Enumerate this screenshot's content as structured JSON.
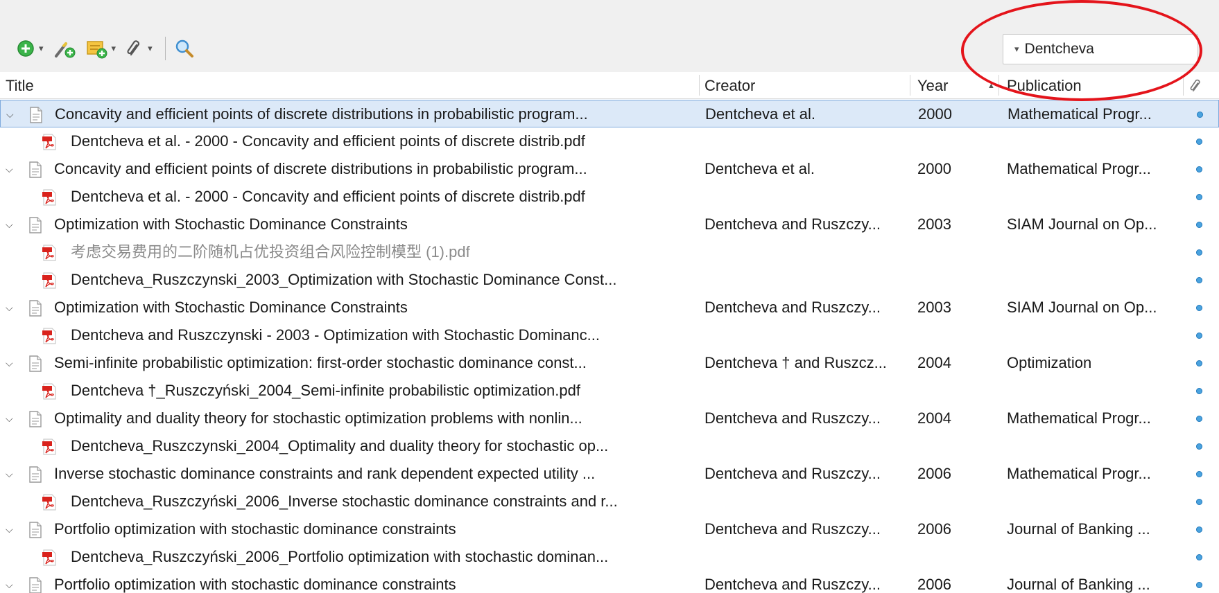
{
  "toolbar": {
    "buttons": [
      {
        "name": "new-item-button",
        "icon": "plus-circle-icon",
        "has_menu": true
      },
      {
        "name": "add-by-identifier-button",
        "icon": "magic-wand-icon",
        "has_menu": false
      },
      {
        "name": "new-note-button",
        "icon": "note-add-icon",
        "has_menu": true
      },
      {
        "name": "add-attachment-button",
        "icon": "paperclip-icon",
        "has_menu": true
      },
      {
        "name": "advanced-search-button",
        "icon": "magnifier-icon",
        "has_menu": false
      }
    ],
    "menu_caret": "▾"
  },
  "search": {
    "mode_caret": "▾",
    "value": "Dentcheva"
  },
  "columns": {
    "title": "Title",
    "creator": "Creator",
    "year": "Year",
    "publication": "Publication",
    "attachments_icon": "paperclip-icon",
    "sort_indicator": "▲"
  },
  "chevron": "⌵",
  "colors": {
    "selection_bg": "#dce9f8",
    "selection_border": "#7eaadd",
    "attachment_dot": "#4aa3df",
    "annotation_ring": "#e4141b",
    "pdf_red": "#d9221c"
  },
  "rows": [
    {
      "type": "parent",
      "title": "Concavity and efficient points of discrete distributions in probabilistic program...",
      "creator": "Dentcheva et al.",
      "year": "2000",
      "publication": "Mathematical Progr...",
      "selected": true
    },
    {
      "type": "child",
      "title": "Dentcheva et al. - 2000 - Concavity and efficient points of discrete distrib.pdf"
    },
    {
      "type": "parent",
      "title": "Concavity and efficient points of discrete distributions in probabilistic program...",
      "creator": "Dentcheva et al.",
      "year": "2000",
      "publication": "Mathematical Progr..."
    },
    {
      "type": "child",
      "title": "Dentcheva et al. - 2000 - Concavity and efficient points of discrete distrib.pdf"
    },
    {
      "type": "parent",
      "title": "Optimization with Stochastic Dominance Constraints",
      "creator": "Dentcheva and Ruszczy...",
      "year": "2003",
      "publication": "SIAM Journal on Op..."
    },
    {
      "type": "child",
      "title": "考虑交易费用的二阶随机占优投资组合风险控制模型 (1).pdf",
      "grey": true
    },
    {
      "type": "child",
      "title": "Dentcheva_Ruszczynski_2003_Optimization with Stochastic Dominance Const..."
    },
    {
      "type": "parent",
      "title": "Optimization with Stochastic Dominance Constraints",
      "creator": "Dentcheva and Ruszczy...",
      "year": "2003",
      "publication": "SIAM Journal on Op..."
    },
    {
      "type": "child",
      "title": "Dentcheva and Ruszczynski - 2003 - Optimization with Stochastic Dominanc..."
    },
    {
      "type": "parent",
      "title": "Semi-infinite probabilistic optimization: first-order stochastic dominance const...",
      "creator": "Dentcheva † and Ruszcz...",
      "year": "2004",
      "publication": "Optimization"
    },
    {
      "type": "child",
      "title": "Dentcheva †_Ruszczyński_2004_Semi-infinite probabilistic optimization.pdf"
    },
    {
      "type": "parent",
      "title": "Optimality and duality theory for stochastic optimization problems with nonlin...",
      "creator": "Dentcheva and Ruszczy...",
      "year": "2004",
      "publication": "Mathematical Progr..."
    },
    {
      "type": "child",
      "title": "Dentcheva_Ruszczynski_2004_Optimality and duality theory for stochastic op..."
    },
    {
      "type": "parent",
      "title": "Inverse stochastic dominance constraints and rank dependent expected utility ...",
      "creator": "Dentcheva and Ruszczy...",
      "year": "2006",
      "publication": "Mathematical Progr..."
    },
    {
      "type": "child",
      "title": "Dentcheva_Ruszczyński_2006_Inverse stochastic dominance constraints and r..."
    },
    {
      "type": "parent",
      "title": "Portfolio optimization with stochastic dominance constraints",
      "creator": "Dentcheva and Ruszczy...",
      "year": "2006",
      "publication": "Journal of Banking ..."
    },
    {
      "type": "child",
      "title": "Dentcheva_Ruszczyński_2006_Portfolio optimization with stochastic dominan..."
    },
    {
      "type": "parent",
      "title": "Portfolio optimization with stochastic dominance constraints",
      "creator": "Dentcheva and Ruszczy...",
      "year": "2006",
      "publication": "Journal of Banking ..."
    }
  ]
}
